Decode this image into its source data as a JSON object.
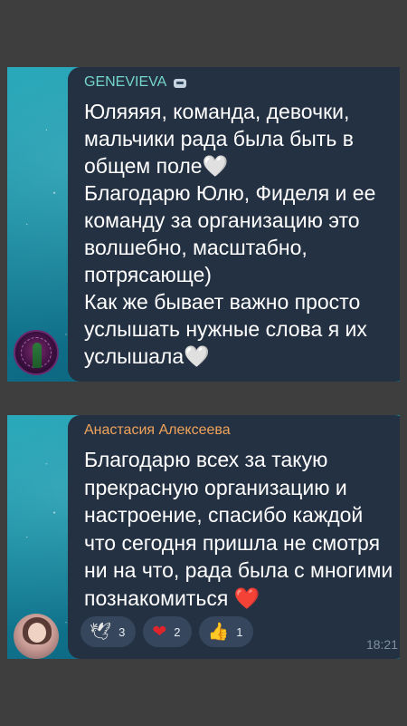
{
  "messages": [
    {
      "sender": "GENEVIEVA",
      "sender_icon": "bot-icon",
      "text": "Юляяяя, команда, девочки, мальчики рада была быть в общем поле🤍\nБлагодарю Юлю, Фиделя и ее команду за организацию это волшебно, масштабно, потрясающе)\nКак же бывает важно просто услышать нужные слова я их услышала🤍"
    },
    {
      "sender": "Анастасия Алексеева",
      "text": "Благодарю всех за такую прекрасную организацию и настроение, спасибо каждой что сегодня пришла не смотря ни на что, рада была с многими познакомиться ❤️",
      "reactions": [
        {
          "emoji": "🕊",
          "icon": "dove-icon",
          "count": "3"
        },
        {
          "emoji": "❤",
          "icon": "heart-icon",
          "count": "2"
        },
        {
          "emoji": "👍",
          "icon": "thumbs-up-icon",
          "count": "1"
        }
      ],
      "time": "18:21"
    }
  ],
  "colors": {
    "bubble": "#243143",
    "sender1": "#74d6c7",
    "sender2": "#f0a35a",
    "background": "#3e3e3e"
  }
}
